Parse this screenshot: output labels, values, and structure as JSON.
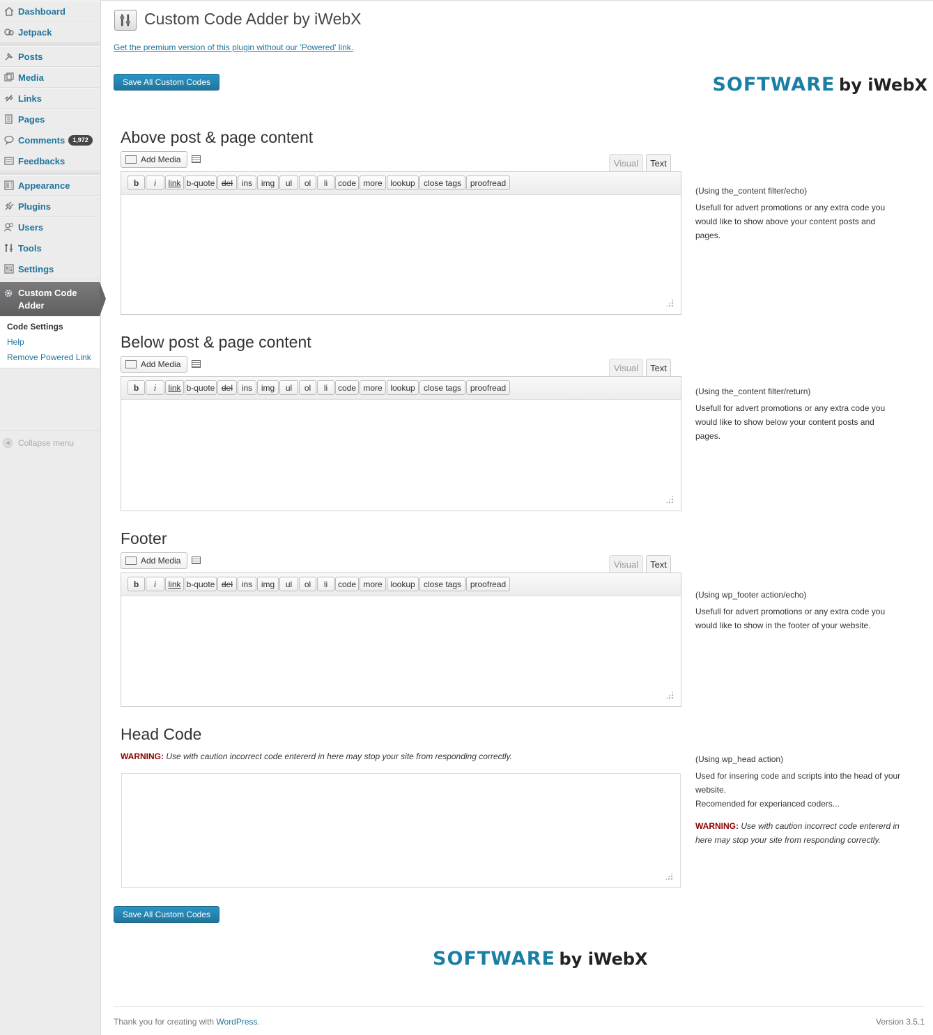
{
  "sidebar": {
    "items": [
      {
        "label": "Dashboard",
        "icon": "dashboard-icon"
      },
      {
        "label": "Jetpack",
        "icon": "jetpack-icon"
      },
      {
        "label": "Posts",
        "icon": "pin-icon"
      },
      {
        "label": "Media",
        "icon": "media-icon"
      },
      {
        "label": "Links",
        "icon": "link-icon"
      },
      {
        "label": "Pages",
        "icon": "pages-icon"
      },
      {
        "label": "Comments",
        "icon": "comments-icon",
        "badge": "1,972"
      },
      {
        "label": "Feedbacks",
        "icon": "feedback-icon"
      },
      {
        "label": "Appearance",
        "icon": "appearance-icon"
      },
      {
        "label": "Plugins",
        "icon": "plugin-icon"
      },
      {
        "label": "Users",
        "icon": "users-icon"
      },
      {
        "label": "Tools",
        "icon": "tools-icon"
      },
      {
        "label": "Settings",
        "icon": "settings-icon"
      }
    ],
    "active": {
      "label_line1": "Custom Code",
      "label_line2": "Adder",
      "icon": "gear-icon"
    },
    "submenu": [
      "Code Settings",
      "Help",
      "Remove Powered Link"
    ],
    "collapse": "Collapse menu"
  },
  "header": {
    "title": "Custom Code Adder by iWebX",
    "premium_link": "Get the premium version of this plugin without our 'Powered' link.",
    "save_label": "Save All Custom Codes",
    "logo_software": "SOFTWARE",
    "logo_by": "by iWebX"
  },
  "editor_common": {
    "add_media": "Add Media",
    "tab_visual": "Visual",
    "tab_text": "Text",
    "toolbar": [
      "b",
      "i",
      "link",
      "b-quote",
      "del",
      "ins",
      "img",
      "ul",
      "ol",
      "li",
      "code",
      "more",
      "lookup",
      "close tags",
      "proofread"
    ]
  },
  "sections": [
    {
      "title": "Above post & page content",
      "desc_using": "(Using the_content filter/echo)",
      "desc_lines": [
        "Usefull for advert promotions or any extra code you",
        "would like to show above your content posts and",
        "pages."
      ]
    },
    {
      "title": "Below post & page content",
      "desc_using": "(Using the_content filter/return)",
      "desc_lines": [
        "Usefull for advert promotions or any extra code you",
        "would like to show below your content posts and",
        "pages."
      ]
    },
    {
      "title": "Footer",
      "desc_using": "(Using wp_footer action/echo)",
      "desc_lines": [
        "Usefull for advert promotions or any extra code you",
        "would like to show in the footer of your website."
      ]
    }
  ],
  "head": {
    "title": "Head Code",
    "warning_label": "WARNING:",
    "warning_text": "Use with caution incorrect code entererd in here may stop your site from responding correctly.",
    "desc_using": "(Using wp_head action)",
    "desc_lines": [
      "Used for insering code and scripts into the head of your",
      "website.",
      "Recomended for experianced coders..."
    ],
    "desc_warning_label": "WARNING:",
    "desc_warning_line1": "Use with caution incorrect code entererd in",
    "desc_warning_line2": "here may stop your site from responding correctly."
  },
  "footer": {
    "thanks_prefix": "Thank you for creating with ",
    "wordpress": "WordPress",
    "thanks_suffix": ".",
    "version": "Version 3.5.1"
  }
}
